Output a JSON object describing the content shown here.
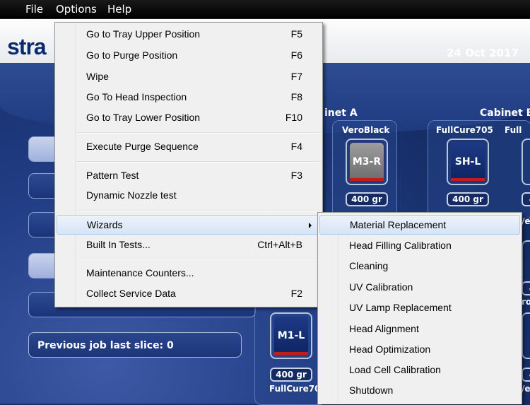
{
  "menubar": {
    "file": "File",
    "options": "Options",
    "help": "Help"
  },
  "header": {
    "logo": "stra",
    "date": "24 Oct 2017"
  },
  "status": {
    "previous_job": "Previous job last slice: 0"
  },
  "cabinets": {
    "a_label": "inet A",
    "b_label": "Cabinet B",
    "a_material_top": "VeroBlack",
    "a_cartridge_top": "M3-R",
    "a_weight_top": "400 gr",
    "b_material_1": "FullCure705",
    "b_cartridge_1": "SH-L",
    "b_weight_1": "400 gr",
    "b_material_2_partial": "Full",
    "left_cartridge": "M1-L",
    "left_weight": "400 gr",
    "left_material_bottom": "FullCure70",
    "right_partial_ve_1": "/e",
    "right_partial_ve_2": "/e",
    "right_partial_ro": "ro",
    "right_partial_4a": "4",
    "right_partial_4b": "4",
    "right_partial_4c": "4",
    "right_partial_4d": "4"
  },
  "options_menu": {
    "items": [
      {
        "label": "Go to Tray Upper Position",
        "shortcut": "F5"
      },
      {
        "label": "Go to Purge Position",
        "shortcut": "F6"
      },
      {
        "label": "Wipe",
        "shortcut": "F7"
      },
      {
        "label": "Go To Head Inspection",
        "shortcut": "F8"
      },
      {
        "label": "Go to Tray Lower Position",
        "shortcut": "F10"
      },
      {
        "label": "Execute Purge Sequence",
        "shortcut": "F4"
      },
      {
        "label": "Pattern Test",
        "shortcut": "F3"
      },
      {
        "label": "Dynamic Nozzle test",
        "shortcut": ""
      },
      {
        "label": "Wizards",
        "shortcut": ""
      },
      {
        "label": "Built In Tests...",
        "shortcut": "Ctrl+Alt+B"
      },
      {
        "label": "Maintenance Counters...",
        "shortcut": ""
      },
      {
        "label": "Collect Service Data",
        "shortcut": "F2"
      }
    ]
  },
  "wizards_menu": {
    "items": [
      "Material Replacement",
      "Head Filling Calibration",
      "Cleaning",
      "UV Calibration",
      "UV Lamp Replacement",
      "Head Alignment",
      "Head Optimization",
      "Load Cell Calibration",
      "Shutdown"
    ]
  },
  "colors": {
    "app_bg": "#1c3578",
    "menu_bg": "#f0f0f0",
    "highlight": "#d6e4f5",
    "cartridge_red": "#c21d1d"
  }
}
